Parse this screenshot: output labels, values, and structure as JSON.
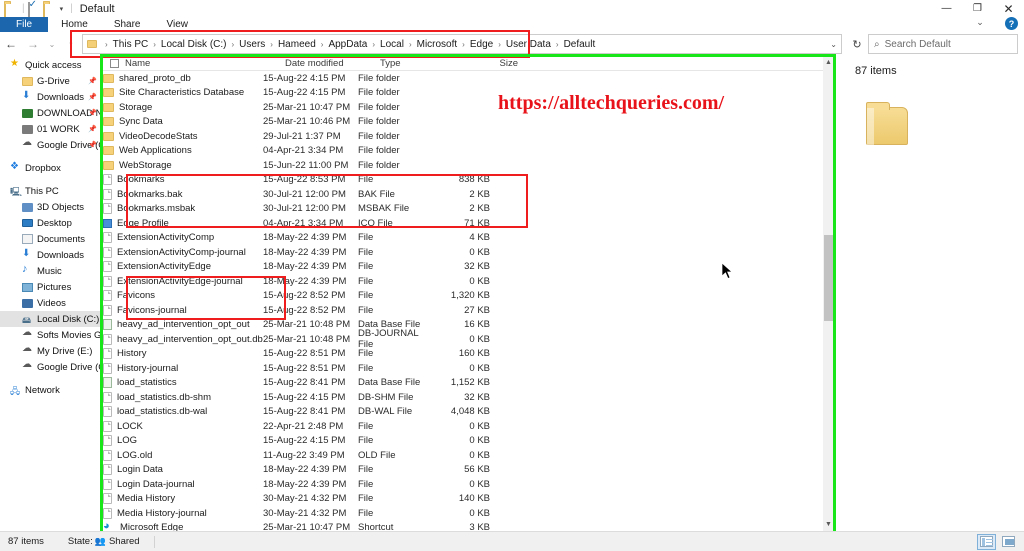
{
  "window": {
    "title": "Default",
    "quick_access_icons": [
      "folder-icon",
      "checkbox-icon",
      "folder-icon"
    ],
    "caret": "▾",
    "controls": {
      "minimize": "—",
      "maximize": "❐",
      "close": "✕",
      "ribbon_collapse": "⌄",
      "help": "?"
    }
  },
  "ribbon": {
    "tabs": [
      {
        "label": "File",
        "active": true
      },
      {
        "label": "Home",
        "active": false
      },
      {
        "label": "Share",
        "active": false
      },
      {
        "label": "View",
        "active": false
      }
    ]
  },
  "navigation": {
    "back": "←",
    "forward": "→",
    "recent": "⌄",
    "up": "↑",
    "refresh": "↻",
    "breadcrumb": [
      "This PC",
      "Local Disk (C:)",
      "Users",
      "Hameed",
      "AppData",
      "Local",
      "Microsoft",
      "Edge",
      "User Data",
      "Default"
    ],
    "breadcrumb_dropdown": "⌄"
  },
  "search": {
    "placeholder": "Search Default",
    "icon": "search-icon"
  },
  "sidebar": {
    "items": [
      {
        "label": "Quick access",
        "icon": "star-icon",
        "indent": false,
        "pin": "",
        "selected": false
      },
      {
        "label": "G-Drive",
        "icon": "folder-icon",
        "indent": true,
        "pin": "📌",
        "selected": false
      },
      {
        "label": "Downloads",
        "icon": "download-icon",
        "indent": true,
        "pin": "📌",
        "selected": false
      },
      {
        "label": "DOWNLOAD NE",
        "icon": "green-folder-icon",
        "indent": true,
        "pin": "📌",
        "selected": false
      },
      {
        "label": "01 WORK",
        "icon": "grey-folder-icon",
        "indent": true,
        "pin": "📌",
        "selected": false
      },
      {
        "label": "Google Drive (G:",
        "icon": "cloud-drive-icon",
        "indent": true,
        "pin": "📌",
        "selected": false
      },
      {
        "label": "Dropbox",
        "icon": "dropbox-icon",
        "indent": false,
        "pin": "",
        "selected": false
      },
      {
        "label": "This PC",
        "icon": "this-pc-icon",
        "indent": false,
        "pin": "",
        "selected": false
      },
      {
        "label": "3D Objects",
        "icon": "3d-objects-icon",
        "indent": true,
        "pin": "",
        "selected": false
      },
      {
        "label": "Desktop",
        "icon": "desktop-icon",
        "indent": true,
        "pin": "",
        "selected": false
      },
      {
        "label": "Documents",
        "icon": "documents-icon",
        "indent": true,
        "pin": "",
        "selected": false
      },
      {
        "label": "Downloads",
        "icon": "download-icon",
        "indent": true,
        "pin": "",
        "selected": false
      },
      {
        "label": "Music",
        "icon": "music-icon",
        "indent": true,
        "pin": "",
        "selected": false
      },
      {
        "label": "Pictures",
        "icon": "pictures-icon",
        "indent": true,
        "pin": "",
        "selected": false
      },
      {
        "label": "Videos",
        "icon": "videos-icon",
        "indent": true,
        "pin": "",
        "selected": false
      },
      {
        "label": "Local Disk (C:)",
        "icon": "disk-icon",
        "indent": true,
        "pin": "",
        "selected": true
      },
      {
        "label": "Softs Movies Games",
        "icon": "cloud-drive-icon",
        "indent": true,
        "pin": "",
        "selected": false
      },
      {
        "label": "My Drive (E:)",
        "icon": "cloud-drive-icon",
        "indent": true,
        "pin": "",
        "selected": false
      },
      {
        "label": "Google Drive (G:)",
        "icon": "cloud-drive-icon",
        "indent": true,
        "pin": "",
        "selected": false
      },
      {
        "label": "Network",
        "icon": "network-icon",
        "indent": false,
        "pin": "",
        "selected": false
      }
    ]
  },
  "filelist": {
    "columns": [
      "Name",
      "Date modified",
      "Type",
      "Size"
    ],
    "select_all_checkbox": "unchecked",
    "rows": [
      {
        "name": "shared_proto_db",
        "date": "15-Aug-22 4:15 PM",
        "type": "File folder",
        "size": "",
        "icon": "folder-icon"
      },
      {
        "name": "Site Characteristics Database",
        "date": "15-Aug-22 4:15 PM",
        "type": "File folder",
        "size": "",
        "icon": "folder-icon"
      },
      {
        "name": "Storage",
        "date": "25-Mar-21 10:47 PM",
        "type": "File folder",
        "size": "",
        "icon": "folder-icon"
      },
      {
        "name": "Sync Data",
        "date": "25-Mar-21 10:46 PM",
        "type": "File folder",
        "size": "",
        "icon": "folder-icon"
      },
      {
        "name": "VideoDecodeStats",
        "date": "29-Jul-21 1:37 PM",
        "type": "File folder",
        "size": "",
        "icon": "folder-icon"
      },
      {
        "name": "Web Applications",
        "date": "04-Apr-21 3:34 PM",
        "type": "File folder",
        "size": "",
        "icon": "folder-icon"
      },
      {
        "name": "WebStorage",
        "date": "15-Jun-22 11:00 PM",
        "type": "File folder",
        "size": "",
        "icon": "folder-icon"
      },
      {
        "name": "Bookmarks",
        "date": "15-Aug-22 8:53 PM",
        "type": "File",
        "size": "838 KB",
        "icon": "file-icon"
      },
      {
        "name": "Bookmarks.bak",
        "date": "30-Jul-21 12:00 PM",
        "type": "BAK File",
        "size": "2 KB",
        "icon": "file-icon"
      },
      {
        "name": "Bookmarks.msbak",
        "date": "30-Jul-21 12:00 PM",
        "type": "MSBAK File",
        "size": "2 KB",
        "icon": "file-icon"
      },
      {
        "name": "Edge Profile",
        "date": "04-Apr-21 3:34 PM",
        "type": "ICO File",
        "size": "71 KB",
        "icon": "ico-icon"
      },
      {
        "name": "ExtensionActivityComp",
        "date": "18-May-22 4:39 PM",
        "type": "File",
        "size": "4 KB",
        "icon": "file-icon"
      },
      {
        "name": "ExtensionActivityComp-journal",
        "date": "18-May-22 4:39 PM",
        "type": "File",
        "size": "0 KB",
        "icon": "file-icon"
      },
      {
        "name": "ExtensionActivityEdge",
        "date": "18-May-22 4:39 PM",
        "type": "File",
        "size": "32 KB",
        "icon": "file-icon"
      },
      {
        "name": "ExtensionActivityEdge-journal",
        "date": "18-May-22 4:39 PM",
        "type": "File",
        "size": "0 KB",
        "icon": "file-icon"
      },
      {
        "name": "Favicons",
        "date": "15-Aug-22 8:52 PM",
        "type": "File",
        "size": "1,320 KB",
        "icon": "file-icon"
      },
      {
        "name": "Favicons-journal",
        "date": "15-Aug-22 8:52 PM",
        "type": "File",
        "size": "27 KB",
        "icon": "file-icon"
      },
      {
        "name": "heavy_ad_intervention_opt_out",
        "date": "25-Mar-21 10:48 PM",
        "type": "Data Base File",
        "size": "16 KB",
        "icon": "database-icon"
      },
      {
        "name": "heavy_ad_intervention_opt_out.db-jou...",
        "date": "25-Mar-21 10:48 PM",
        "type": "DB-JOURNAL File",
        "size": "0 KB",
        "icon": "file-icon"
      },
      {
        "name": "History",
        "date": "15-Aug-22 8:51 PM",
        "type": "File",
        "size": "160 KB",
        "icon": "file-icon"
      },
      {
        "name": "History-journal",
        "date": "15-Aug-22 8:51 PM",
        "type": "File",
        "size": "0 KB",
        "icon": "file-icon"
      },
      {
        "name": "load_statistics",
        "date": "15-Aug-22 8:41 PM",
        "type": "Data Base File",
        "size": "1,152 KB",
        "icon": "database-icon"
      },
      {
        "name": "load_statistics.db-shm",
        "date": "15-Aug-22 4:15 PM",
        "type": "DB-SHM File",
        "size": "32 KB",
        "icon": "file-icon"
      },
      {
        "name": "load_statistics.db-wal",
        "date": "15-Aug-22 8:41 PM",
        "type": "DB-WAL File",
        "size": "4,048 KB",
        "icon": "file-icon"
      },
      {
        "name": "LOCK",
        "date": "22-Apr-21 2:48 PM",
        "type": "File",
        "size": "0 KB",
        "icon": "file-icon"
      },
      {
        "name": "LOG",
        "date": "15-Aug-22 4:15 PM",
        "type": "File",
        "size": "0 KB",
        "icon": "file-icon"
      },
      {
        "name": "LOG.old",
        "date": "11-Aug-22 3:49 PM",
        "type": "OLD File",
        "size": "0 KB",
        "icon": "file-icon"
      },
      {
        "name": "Login Data",
        "date": "18-May-22 4:39 PM",
        "type": "File",
        "size": "56 KB",
        "icon": "file-icon"
      },
      {
        "name": "Login Data-journal",
        "date": "18-May-22 4:39 PM",
        "type": "File",
        "size": "0 KB",
        "icon": "file-icon"
      },
      {
        "name": "Media History",
        "date": "30-May-21 4:32 PM",
        "type": "File",
        "size": "140 KB",
        "icon": "file-icon"
      },
      {
        "name": "Media History-journal",
        "date": "30-May-21 4:32 PM",
        "type": "File",
        "size": "0 KB",
        "icon": "file-icon"
      },
      {
        "name": "Microsoft Edge",
        "date": "25-Mar-21 10:47 PM",
        "type": "Shortcut",
        "size": "3 KB",
        "icon": "edge-shortcut-icon"
      }
    ]
  },
  "details_pane": {
    "items_count": "87 items",
    "preview_icon": "large-folder-icon"
  },
  "watermark": {
    "text": "https://alltechqueries.com/",
    "color": "#e8131a"
  },
  "statusbar": {
    "items_count": "87 items",
    "state_label": "State:",
    "state_value": "Shared",
    "state_icon": "shared-people-icon",
    "view_details_button": "details-view-icon",
    "view_large_icons_button": "large-icons-view-icon"
  },
  "scrollbar": {
    "up_arrow": "▲",
    "down_arrow": "▼"
  },
  "annotations": {
    "accent_red": "#ef1d1d",
    "accent_green": "#19e619",
    "boxes": [
      {
        "name": "address-bar-highlight",
        "color": "#ef1d1d"
      },
      {
        "name": "bookmarks-files-highlight",
        "color": "#ef1d1d"
      },
      {
        "name": "favicons-files-highlight",
        "color": "#ef1d1d"
      },
      {
        "name": "file-list-pane-highlight",
        "color": "#19e619"
      }
    ]
  }
}
